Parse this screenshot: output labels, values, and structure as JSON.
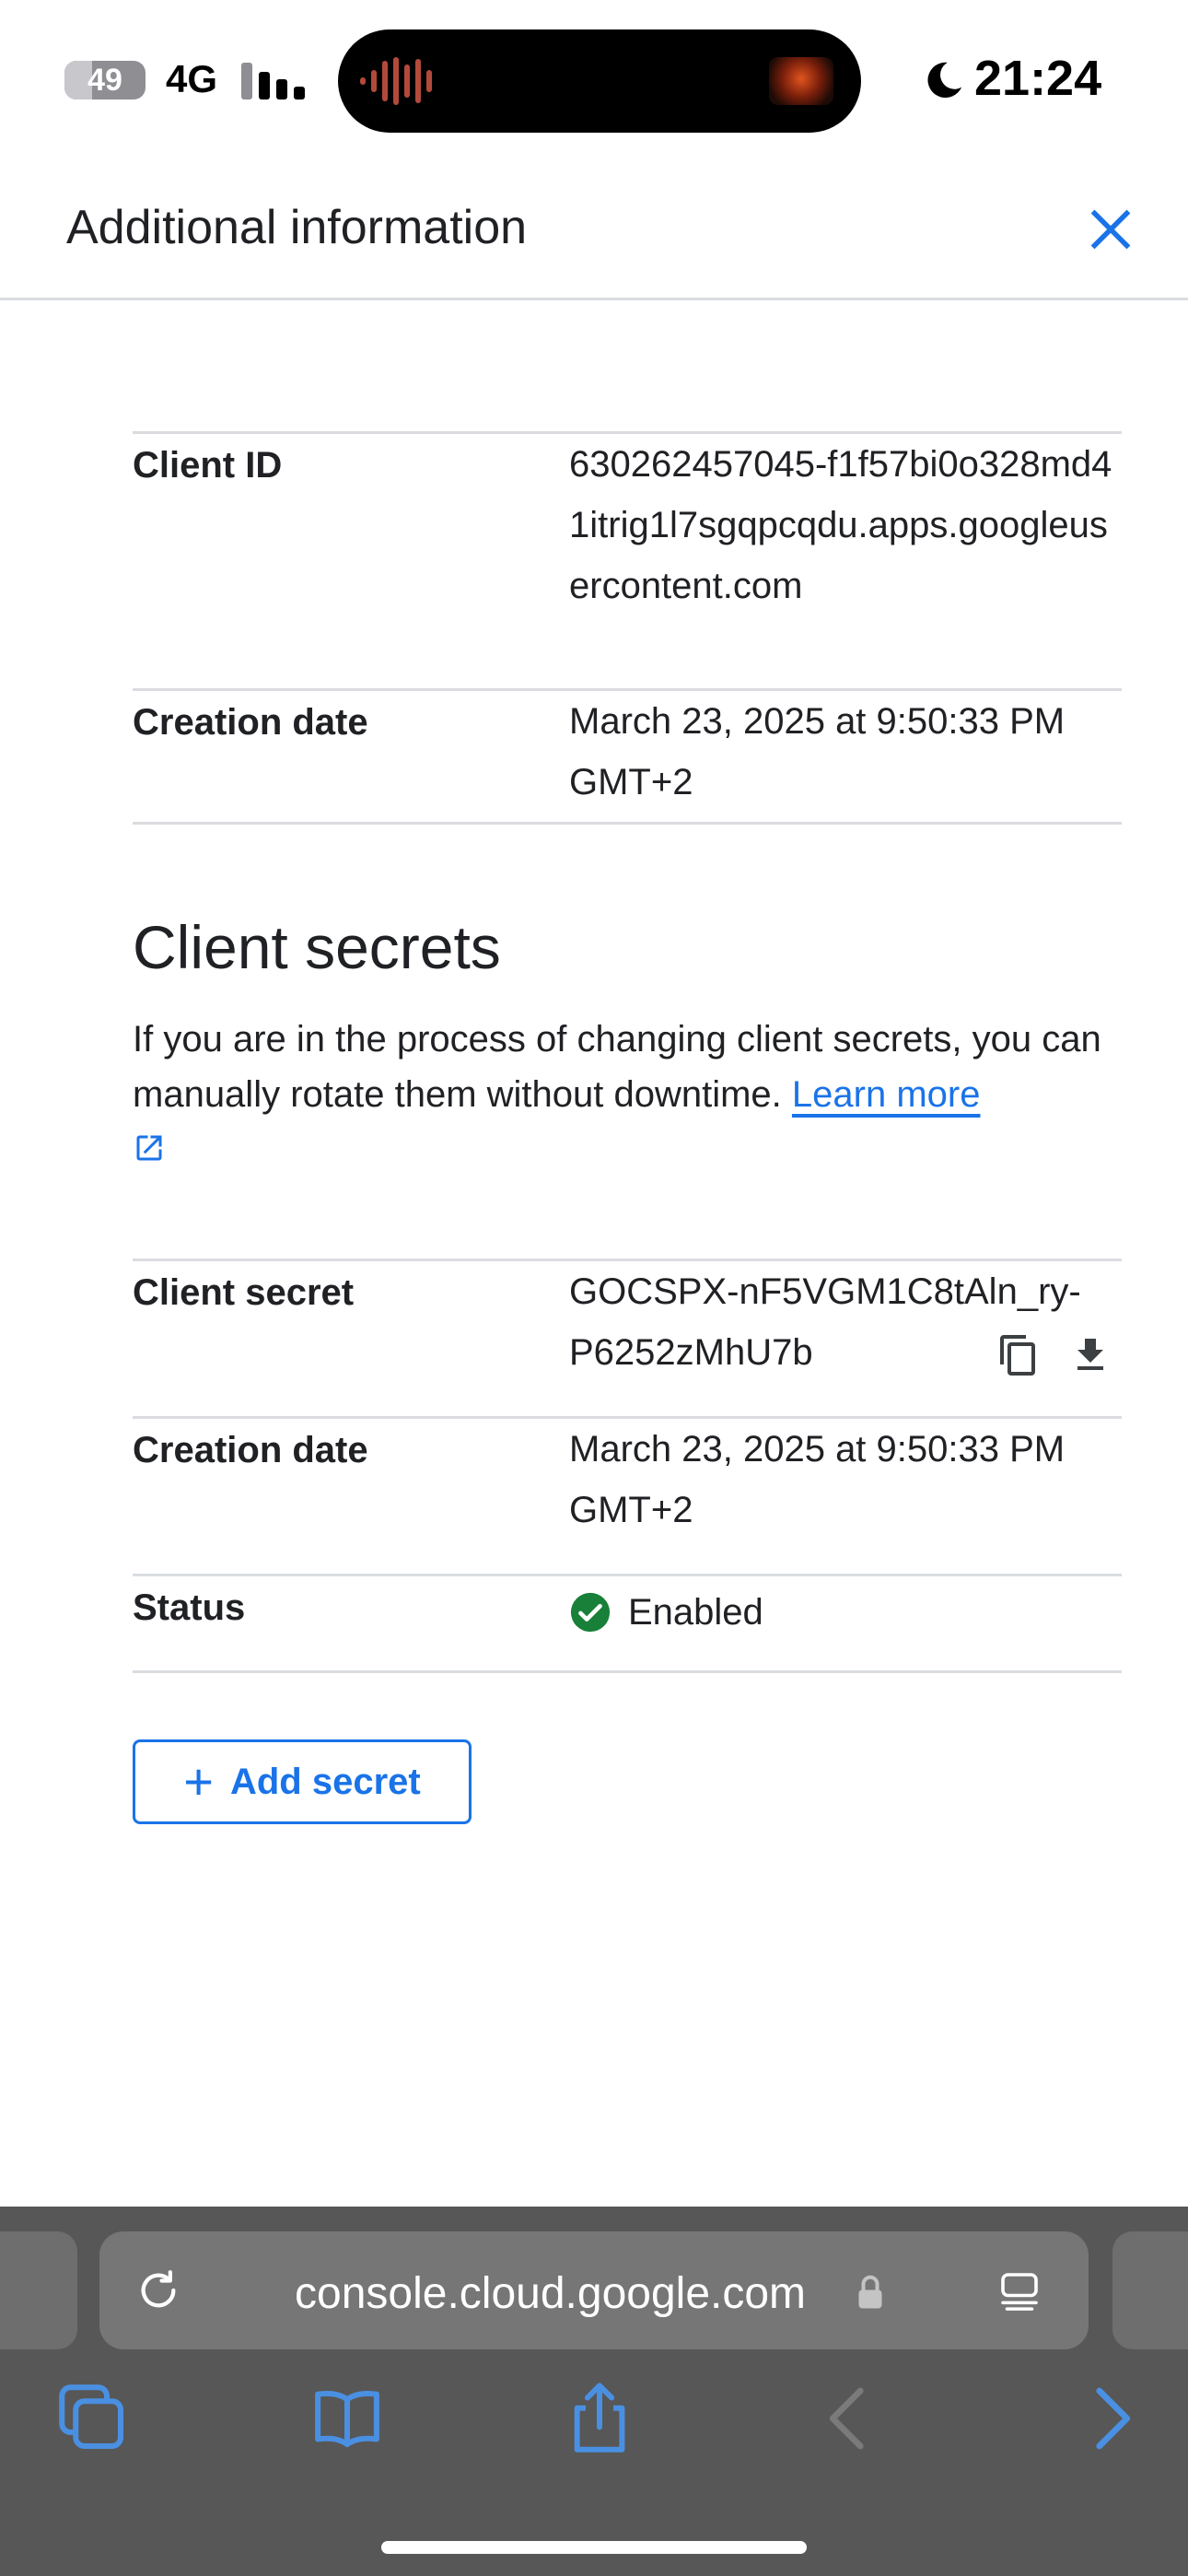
{
  "status_bar": {
    "battery": "49",
    "network": "4G",
    "time": "21:24"
  },
  "header": {
    "title": "Additional information"
  },
  "client_info": {
    "rows": [
      {
        "key": "Client ID",
        "value": "630262457045-f1f57bi0o328md41itrig1l7sgqpcqdu.apps.googleusercontent.com"
      },
      {
        "key": "Creation date",
        "value": "March 23, 2025 at 9:50:33 PM GMT+2"
      }
    ]
  },
  "secrets_section": {
    "title": "Client secrets",
    "description": "If you are in the process of changing client secrets, you can manually rotate them without downtime.",
    "learn_more": "Learn more",
    "rows": {
      "secret_label": "Client secret",
      "secret_value": "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",
      "date_label": "Creation date",
      "date_value": "March 23, 2025 at 9:50:33 PM GMT+2",
      "status_label": "Status",
      "status_value": "Enabled"
    },
    "add_button": "Add secret"
  },
  "browser": {
    "url": "console.cloud.google.com"
  },
  "colors": {
    "accent": "#1a73e8",
    "success": "#188038",
    "divider": "#dadce0"
  }
}
